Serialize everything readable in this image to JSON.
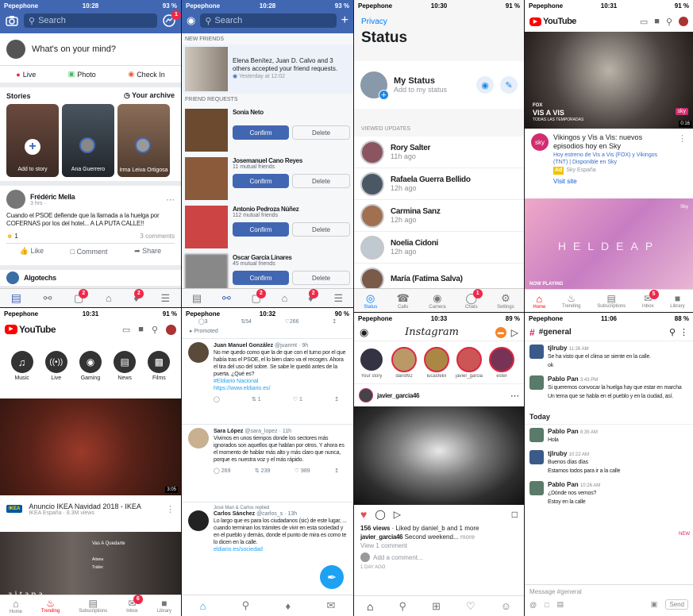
{
  "fb_feed": {
    "carrier": "Pepephone",
    "time": "10:28",
    "battery": "93 %",
    "search_placeholder": "Search",
    "messenger_badge": "1",
    "composer_prompt": "What's on your mind?",
    "actions": [
      "Live",
      "Photo",
      "Check In"
    ],
    "stories_title": "Stories",
    "stories_archive": "Your archive",
    "add_story": "Add to story",
    "story_names": [
      "Ana Guerrero",
      "Irma Leiva Ortigosa"
    ],
    "post_author": "Frédéric Mella",
    "post_meta": "3 hrs ·",
    "post_text": "Cuando el PSOE defiende que la llamada a la huelga por COFERNAS por los del hotel... A LA PUTA CALLE!!",
    "post_reactions": "1",
    "post_comments": "3 comments",
    "post_actions": [
      "Like",
      "Comment",
      "Share"
    ],
    "next_post": "Algotechs",
    "tab_badges": [
      "2",
      "2"
    ]
  },
  "fb_notif": {
    "carrier": "Pepephone",
    "time": "10:28",
    "battery": "93 %",
    "search_placeholder": "Search",
    "new_friends_header": "NEW FRIENDS",
    "new_friends_text": "Elena Benítez, Juan D. Calvo and 3 others accepted your friend requests.",
    "new_friends_time": "Yesterday at 12:02",
    "requests_header": "FRIEND REQUESTS",
    "requests": [
      {
        "name": "Sonia Neto",
        "mutual": ""
      },
      {
        "name": "Josemanuel Cano Reyes",
        "mutual": "11 mutual friends"
      },
      {
        "name": "Antonio Pedroza Núñez",
        "mutual": "112 mutual friends"
      },
      {
        "name": "Oscar García Linares",
        "mutual": "45 mutual friends"
      }
    ],
    "confirm": "Confirm",
    "delete": "Delete",
    "tab_badges": [
      "2",
      "2"
    ]
  },
  "wa": {
    "carrier": "Pepephone",
    "time": "10:30",
    "battery": "91 %",
    "privacy": "Privacy",
    "title": "Status",
    "my_status": "My Status",
    "my_status_sub": "Add to my status",
    "viewed": "VIEWED UPDATES",
    "updates": [
      {
        "name": "Rory Salter",
        "time": "11h ago"
      },
      {
        "name": "Rafaela Guerra Bellido",
        "time": "12h ago"
      },
      {
        "name": "Carmina Sanz",
        "time": "12h ago"
      },
      {
        "name": "Noelia Cidoni",
        "time": "12h ago"
      },
      {
        "name": "María (Fatima Salva)",
        "time": ""
      }
    ],
    "tabs": [
      "Status",
      "Calls",
      "Camera",
      "Chats",
      "Settings"
    ],
    "chats_badge": "1"
  },
  "yt_top": {
    "carrier": "Pepephone",
    "time": "10:31",
    "battery": "91 %",
    "logo": "YouTube",
    "ad_overlay": "VIS A VIS",
    "ad_overlay_sub": "TODAS LAS TEMPORADAS",
    "ad_channel": "FOX",
    "ad_corner": "sky",
    "ad_time": "0:16",
    "ad_title": "Vikingos y Vis a Vis: nuevos episodios hoy en Sky",
    "ad_desc": "Hoy estreno de Vis a Vis (FOX) y Vikingos (TNT) | Disponible en Sky",
    "ad_badge": "Ad",
    "ad_brand": "Sky España",
    "ad_cta": "Visit site",
    "video2_text": "HELDEAP",
    "video2_label": "NOW PLAYING",
    "video2_brand": "Sky",
    "tabs": [
      "Home",
      "Trending",
      "Subscriptions",
      "Inbox",
      "Library"
    ],
    "inbox_badge": "5"
  },
  "yt_bot": {
    "carrier": "Pepephone",
    "time": "10:31",
    "battery": "91 %",
    "logo": "YouTube",
    "cats": [
      "Music",
      "Live",
      "Gaming",
      "News",
      "Films"
    ],
    "video_time": "3:05",
    "video_title": "Anuncio IKEA Navidad 2018 - IKEA",
    "video_meta": "IKEA España · 8.3M views",
    "ikea": "IKEA",
    "video2_title": "Vas A Quedarte",
    "video2_sub": "Aitana",
    "video2_sub2": "Tráiler",
    "video2_text": "aitana",
    "tabs": [
      "Home",
      "Trending",
      "Subscriptions",
      "Inbox",
      "Library"
    ],
    "inbox_badge": "6"
  },
  "tw": {
    "carrier": "Pepephone",
    "time": "10:32",
    "battery": "90 %",
    "top_counts": [
      "3",
      "54",
      "266"
    ],
    "promoted": "Promoted",
    "tweets": [
      {
        "name": "Juan Manuel González",
        "handle": "@juanmt · 9h",
        "text": "No me quedo como que la de que con el turno por el que había tras el PSOE, el lo bien claro va el recogen. Ahora el tira del uso del sobre. Se sabe le quedó antes de la puerta. ¿Qué es?",
        "link": "#Eldiario Nacional",
        "link2": "https://www.eldiario.es/",
        "counts": [
          "",
          "1",
          "1",
          ""
        ]
      },
      {
        "name": "Sara López",
        "handle": "@sara_lopez · 11h",
        "text": "Vivimos en unos tiempos donde los sectores más ignorados son aquellos que hablan por otros. Y ahora es el momento de hablar más alto y más claro que nunca, porque es nuestra voz y el más rápido.",
        "counts": [
          "269",
          "239",
          "989"
        ]
      },
      {
        "replied": "José Mari & Carlos replied",
        "name": "Carlos Sánchez",
        "handle": "@carlos_s · 13h",
        "text": "Lo largo que es para los ciudadanos (sic) de este lugar, ... cuando terminan los trámites de vivir en esta sociedad y en el pueblo y demás, donde el punto de mira es como te lo dicen en la calle.",
        "link": "eldiario.es/sociedad",
        "counts": []
      }
    ],
    "tab_badge": ""
  },
  "ig": {
    "carrier": "Pepephone",
    "time": "10:33",
    "battery": "89 %",
    "logo": "Instagram",
    "stories": [
      "Your story",
      "dani992",
      "lucasfelix",
      "javier_garcia",
      "ester"
    ],
    "post_user": "javier_garcia46",
    "views": "156 views",
    "liked_by": "Liked by daniel_b and 1 more",
    "caption_user": "javier_garcia46",
    "caption": "Second weekend...",
    "more": "more",
    "view_comments": "View 1 comment",
    "add_comment": "Add a comment...",
    "ago": "1 DAY AGO"
  },
  "slack": {
    "carrier": "Pepephone",
    "time": "11:06",
    "battery": "88 %",
    "channel": "#general",
    "messages": [
      {
        "name": "tjlruby",
        "time": "11:26 AM",
        "text": "Se ha visto que el clima se siente en la calle.",
        "text2": "ok"
      },
      {
        "name": "Pablo Pan",
        "time": "3:43 PM",
        "text": "Si queremos convocar la huelga hay que estar en marcha",
        "text2": "Un tema que se habla en el pueblo y en la ciudad, así."
      }
    ],
    "divider": "Today",
    "messages_today": [
      {
        "name": "Pablo Pan",
        "time": "8:35 AM",
        "text": "Hola"
      },
      {
        "name": "tjlruby",
        "time": "10:22 AM",
        "text": "Buenos días días",
        "text2": "Estamos todos para ir a la calle"
      },
      {
        "name": "Pablo Pan",
        "time": "10:26 AM",
        "text": "¿Dónde nos vemos?",
        "text2": "Estoy en la calle"
      }
    ],
    "new_label": "NEW",
    "input_placeholder": "Message #general",
    "send": "Send"
  }
}
